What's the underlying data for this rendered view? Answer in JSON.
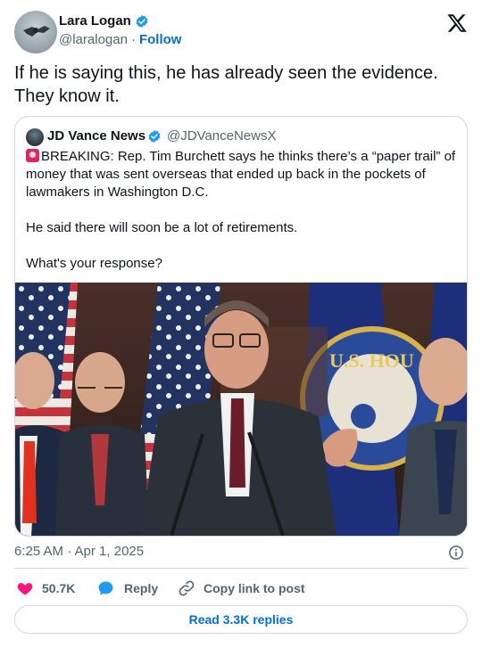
{
  "author": {
    "name": "Lara Logan",
    "handle": "@laralogan",
    "separator": "·",
    "follow_label": "Follow"
  },
  "tweet": {
    "text": "If he is saying this, he has already seen the evidence. They know it."
  },
  "quoted_tweet": {
    "name": "JD Vance News",
    "handle": "@JDVanceNewsX",
    "paragraphs": [
      "BREAKING: Rep. Tim Burchett says he thinks there’s a “paper trail” of money that was sent overseas that ended up back in the pockets of lawmakers in Washington D.C.",
      "He said there will soon be a lot of retirements.",
      "What's your response?"
    ],
    "seal_text": "U.S. HOU"
  },
  "meta": {
    "timestamp": "6:25 AM · Apr 1, 2025"
  },
  "actions": {
    "likes": "50.7K",
    "reply_label": "Reply",
    "copy_link_label": "Copy link to post"
  },
  "read_replies_label": "Read 3.3K replies",
  "colors": {
    "link": "#006fd6",
    "verified": "#1d9bf0",
    "like": "#f91880",
    "reply": "#1d9bf0",
    "secondary_text": "#536471",
    "border": "#cfd9de"
  },
  "icons": [
    "verified-badge-icon",
    "x-logo-icon",
    "siren-icon",
    "info-icon",
    "heart-icon",
    "reply-bubble-icon",
    "link-icon"
  ]
}
